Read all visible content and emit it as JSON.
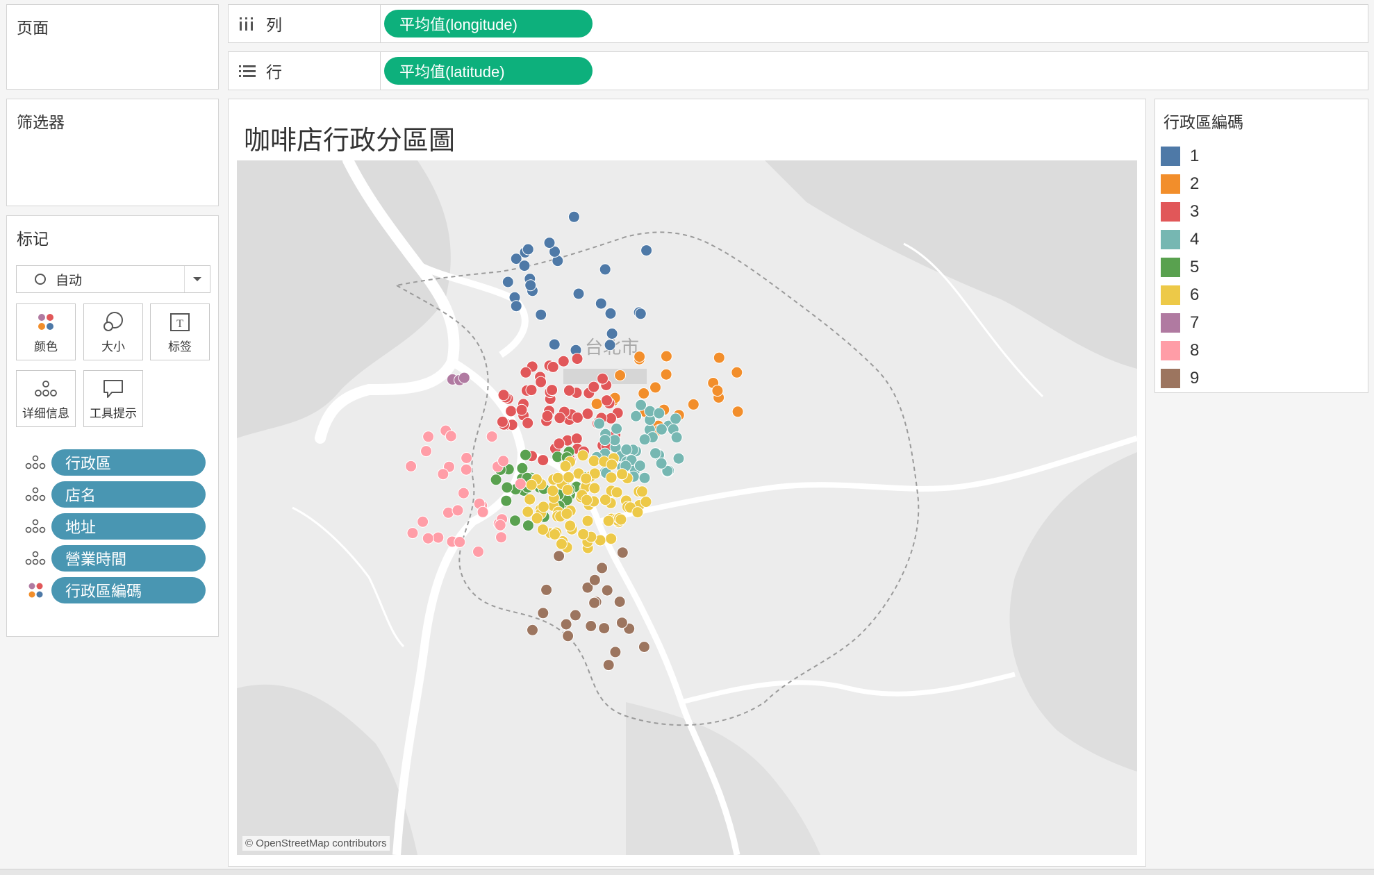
{
  "pages_panel": {
    "title": "页面"
  },
  "filters_panel": {
    "title": "筛选器"
  },
  "marks_panel": {
    "title": "标记",
    "mark_type": "自动",
    "buttons": {
      "color": "颜色",
      "size": "大小",
      "label": "标签",
      "detail": "详细信息",
      "tooltip": "工具提示"
    },
    "fields": [
      {
        "label": "行政區",
        "encoding": "detail"
      },
      {
        "label": "店名",
        "encoding": "detail"
      },
      {
        "label": "地址",
        "encoding": "detail"
      },
      {
        "label": "營業時間",
        "encoding": "detail"
      },
      {
        "label": "行政區編碼",
        "encoding": "color"
      }
    ]
  },
  "shelves": {
    "columns": {
      "label": "列",
      "pill": "平均值(longitude)"
    },
    "rows": {
      "label": "行",
      "pill": "平均值(latitude)"
    }
  },
  "viz": {
    "title": "咖啡店行政分區圖",
    "map_city_label": "台北市",
    "map_credit": "© OpenStreetMap contributors"
  },
  "legend": {
    "title": "行政區編碼",
    "items": [
      {
        "label": "1",
        "color": "#4e79a7"
      },
      {
        "label": "2",
        "color": "#f28e2b"
      },
      {
        "label": "3",
        "color": "#e15759"
      },
      {
        "label": "4",
        "color": "#76b7b2"
      },
      {
        "label": "5",
        "color": "#59a14f"
      },
      {
        "label": "6",
        "color": "#edc948"
      },
      {
        "label": "7",
        "color": "#b07aa1"
      },
      {
        "label": "8",
        "color": "#ff9da7"
      },
      {
        "label": "9",
        "color": "#9c755f"
      }
    ]
  },
  "icons": {
    "columns": "columns-icon",
    "rows": "rows-icon",
    "color": "color-dots-icon",
    "size": "size-circles-icon",
    "label": "text-label-icon",
    "detail": "detail-dots-icon",
    "tooltip": "speech-bubble-icon"
  }
}
